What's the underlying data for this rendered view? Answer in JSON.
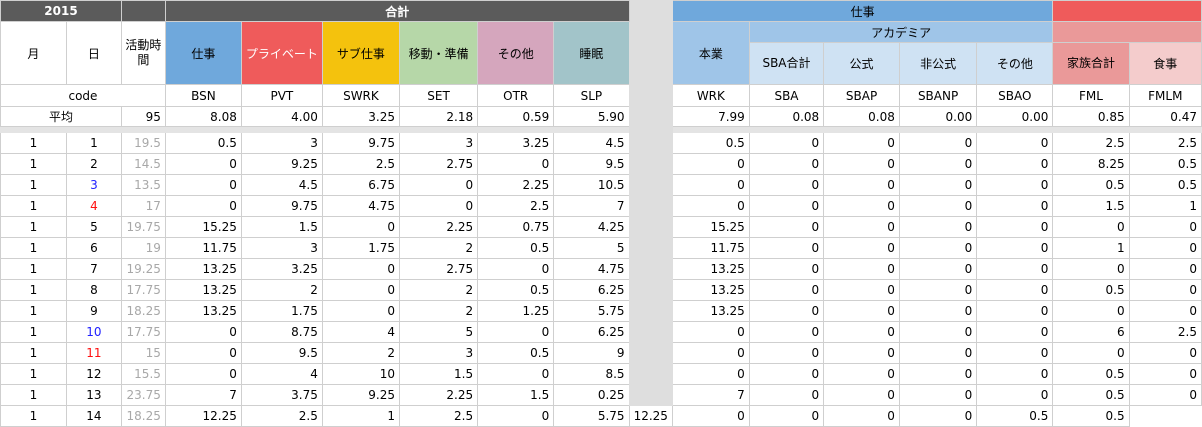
{
  "sheet": {
    "year_label": "2015",
    "group_total": "合計",
    "group_work": "仕事",
    "group_academia": "アカデミア",
    "col_month": "月",
    "col_day": "日",
    "col_active": "活動時間",
    "categories": [
      "仕事",
      "プライベート",
      "サブ仕事",
      "移動・準備",
      "その他",
      "睡眠"
    ],
    "work_cols": [
      "本業",
      "SBA合計",
      "公式",
      "非公式",
      "その他"
    ],
    "family_cols": [
      "家族合計",
      "食事"
    ],
    "code_label": "code",
    "codes": [
      "BSN",
      "PVT",
      "SWRK",
      "SET",
      "OTR",
      "SLP",
      "WRK",
      "SBA",
      "SBAP",
      "SBANP",
      "SBAO",
      "FML",
      "FMLM"
    ],
    "average_label": "平均",
    "average_active": "95",
    "averages": [
      "8.08",
      "4.00",
      "3.25",
      "2.18",
      "0.59",
      "5.90",
      "7.99",
      "0.08",
      "0.08",
      "0.00",
      "0.00",
      "0.85",
      "0.47"
    ],
    "rows": [
      {
        "m": "1",
        "d": "1",
        "a": "19.5",
        "v": [
          "0.5",
          "3",
          "9.75",
          "3",
          "3.25",
          "4.5",
          "0.5",
          "0",
          "0",
          "0",
          "0",
          "2.5",
          "2.5"
        ]
      },
      {
        "m": "1",
        "d": "2",
        "a": "14.5",
        "v": [
          "0",
          "9.25",
          "2.5",
          "2.75",
          "0",
          "9.5",
          "0",
          "0",
          "0",
          "0",
          "0",
          "8.25",
          "0.5"
        ]
      },
      {
        "m": "1",
        "d": "3",
        "a": "13.5",
        "dc": "blue",
        "v": [
          "0",
          "4.5",
          "6.75",
          "0",
          "2.25",
          "10.5",
          "0",
          "0",
          "0",
          "0",
          "0",
          "0.5",
          "0.5"
        ]
      },
      {
        "m": "1",
        "d": "4",
        "a": "17",
        "dc": "red",
        "v": [
          "0",
          "9.75",
          "4.75",
          "0",
          "2.5",
          "7",
          "0",
          "0",
          "0",
          "0",
          "0",
          "1.5",
          "1"
        ]
      },
      {
        "m": "1",
        "d": "5",
        "a": "19.75",
        "v": [
          "15.25",
          "1.5",
          "0",
          "2.25",
          "0.75",
          "4.25",
          "15.25",
          "0",
          "0",
          "0",
          "0",
          "0",
          "0"
        ]
      },
      {
        "m": "1",
        "d": "6",
        "a": "19",
        "v": [
          "11.75",
          "3",
          "1.75",
          "2",
          "0.5",
          "5",
          "11.75",
          "0",
          "0",
          "0",
          "0",
          "1",
          "0"
        ]
      },
      {
        "m": "1",
        "d": "7",
        "a": "19.25",
        "v": [
          "13.25",
          "3.25",
          "0",
          "2.75",
          "0",
          "4.75",
          "13.25",
          "0",
          "0",
          "0",
          "0",
          "0",
          "0"
        ]
      },
      {
        "m": "1",
        "d": "8",
        "a": "17.75",
        "v": [
          "13.25",
          "2",
          "0",
          "2",
          "0.5",
          "6.25",
          "13.25",
          "0",
          "0",
          "0",
          "0",
          "0.5",
          "0"
        ]
      },
      {
        "m": "1",
        "d": "9",
        "a": "18.25",
        "v": [
          "13.25",
          "1.75",
          "0",
          "2",
          "1.25",
          "5.75",
          "13.25",
          "0",
          "0",
          "0",
          "0",
          "0",
          "0"
        ]
      },
      {
        "m": "1",
        "d": "10",
        "a": "17.75",
        "dc": "blue",
        "v": [
          "0",
          "8.75",
          "4",
          "5",
          "0",
          "6.25",
          "0",
          "0",
          "0",
          "0",
          "0",
          "6",
          "2.5"
        ]
      },
      {
        "m": "1",
        "d": "11",
        "a": "15",
        "dc": "red",
        "v": [
          "0",
          "9.5",
          "2",
          "3",
          "0.5",
          "9",
          "0",
          "0",
          "0",
          "0",
          "0",
          "0",
          "0"
        ]
      },
      {
        "m": "1",
        "d": "12",
        "a": "15.5",
        "v": [
          "0",
          "4",
          "10",
          "1.5",
          "0",
          "8.5",
          "0",
          "0",
          "0",
          "0",
          "0",
          "0.5",
          "0"
        ]
      },
      {
        "m": "1",
        "d": "13",
        "a": "23.75",
        "v": [
          "7",
          "3.75",
          "9.25",
          "2.25",
          "1.5",
          "0.25",
          "7",
          "0",
          "0",
          "0",
          "0",
          "0.5",
          "0"
        ]
      },
      {
        "m": "1",
        "d": "14",
        "a": "18.25",
        "v": [
          "12.25",
          "2.5",
          "1",
          "2.5",
          "0",
          "5.75",
          "12.25",
          "0",
          "0",
          "0",
          "0",
          "0.5",
          "0.5"
        ]
      }
    ]
  }
}
